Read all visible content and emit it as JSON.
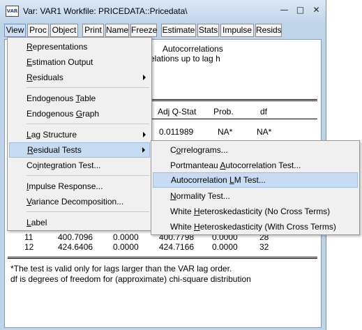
{
  "window": {
    "icon_label": "VAR",
    "title": "Var: VAR1   Workfile: PRICEDATA::Pricedata\\"
  },
  "toolbar": [
    "View",
    "Proc",
    "Object",
    "Print",
    "Name",
    "Freeze",
    "Estimate",
    "Stats",
    "Impulse",
    "Resids"
  ],
  "content": {
    "header_line1": "Autocorrelations",
    "header_line2": "elations up to lag h",
    "columns": [
      "Adj Q-Stat",
      "Prob.",
      "df"
    ],
    "first_row_partial": [
      "0.011989",
      "NA*",
      "NA*"
    ],
    "rows": [
      {
        "lag": "11",
        "q": "400.7096",
        "p1": "0.0000",
        "adjq": "400.7798",
        "p2": "0.0000",
        "df": "28"
      },
      {
        "lag": "12",
        "q": "424.6406",
        "p1": "0.0000",
        "adjq": "424.7166",
        "p2": "0.0000",
        "df": "32"
      }
    ],
    "footnote1": "*The test is valid only for lags larger than the VAR lag order.",
    "footnote2": "df is degrees of freedom for (approximate) chi-square distribution"
  },
  "view_menu": {
    "representations": [
      "",
      "R",
      "epresentations"
    ],
    "estimation_output": [
      "",
      "E",
      "stimation Output"
    ],
    "residuals": [
      "",
      "R",
      "esiduals"
    ],
    "endogenous_table": [
      "Endogenous ",
      "T",
      "able"
    ],
    "endogenous_graph": [
      "Endogenous ",
      "G",
      "raph"
    ],
    "lag_structure": [
      "",
      "L",
      "ag Structure"
    ],
    "residual_tests": [
      "",
      "R",
      "esidual Tests"
    ],
    "cointegration_test": [
      "Co",
      "i",
      "ntegration Test..."
    ],
    "impulse_response": [
      "",
      "I",
      "mpulse Response..."
    ],
    "variance_decomposition": [
      "",
      "V",
      "ariance Decomposition..."
    ],
    "label": [
      "",
      "L",
      "abel"
    ]
  },
  "residual_tests_menu": {
    "correlograms": [
      "C",
      "o",
      "rrelograms..."
    ],
    "portmanteau": [
      "Portmanteau ",
      "A",
      "utocorrelation Test..."
    ],
    "autocorrelation_lm": [
      "Autocorrelation ",
      "L",
      "M Test..."
    ],
    "normality": [
      "",
      "N",
      "ormality Test..."
    ],
    "white_no_cross": [
      "White ",
      "H",
      "eteroskedasticity (No Cross Terms)"
    ],
    "white_cross": [
      "White ",
      "H",
      "eteroskedasticity (With Cross Terms)"
    ]
  }
}
